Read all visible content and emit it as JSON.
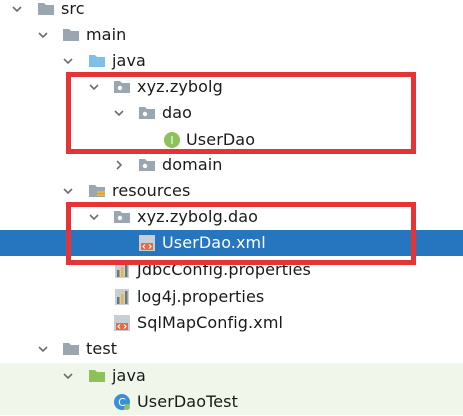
{
  "tree": {
    "nodes": [
      {
        "label": "src",
        "icon": "folder-icon",
        "expanded": true
      },
      {
        "label": "main",
        "icon": "folder-icon",
        "expanded": true
      },
      {
        "label": "java",
        "icon": "source-folder-icon",
        "expanded": true
      },
      {
        "label": "xyz.zybolg",
        "icon": "package-icon",
        "expanded": true
      },
      {
        "label": "dao",
        "icon": "package-icon",
        "expanded": true
      },
      {
        "label": "UserDao",
        "icon": "interface-icon"
      },
      {
        "label": "domain",
        "icon": "package-icon",
        "expanded": false
      },
      {
        "label": "resources",
        "icon": "resources-folder-icon",
        "expanded": true
      },
      {
        "label": "xyz.zybolg.dao",
        "icon": "package-icon",
        "expanded": true
      },
      {
        "label": "UserDao.xml",
        "icon": "xml-file-icon",
        "selected": true
      },
      {
        "label": "JdbcConfig.properties",
        "icon": "properties-file-icon"
      },
      {
        "label": "log4j.properties",
        "icon": "properties-file-icon"
      },
      {
        "label": "SqlMapConfig.xml",
        "icon": "xml-file-icon"
      },
      {
        "label": "test",
        "icon": "folder-icon",
        "expanded": true
      },
      {
        "label": "java",
        "icon": "test-source-folder-icon",
        "expanded": true
      },
      {
        "label": "UserDaoTest",
        "icon": "class-icon"
      }
    ]
  },
  "colors": {
    "selection": "#2675bf",
    "highlight_box": "#e53436",
    "test_background": "#f0f7ea",
    "folder": "#9aa7b0",
    "source_folder": "#7fc0e8",
    "test_folder": "#8dc15a",
    "interface_badge": "#8dc15a",
    "class_badge": "#3b8fd6"
  }
}
